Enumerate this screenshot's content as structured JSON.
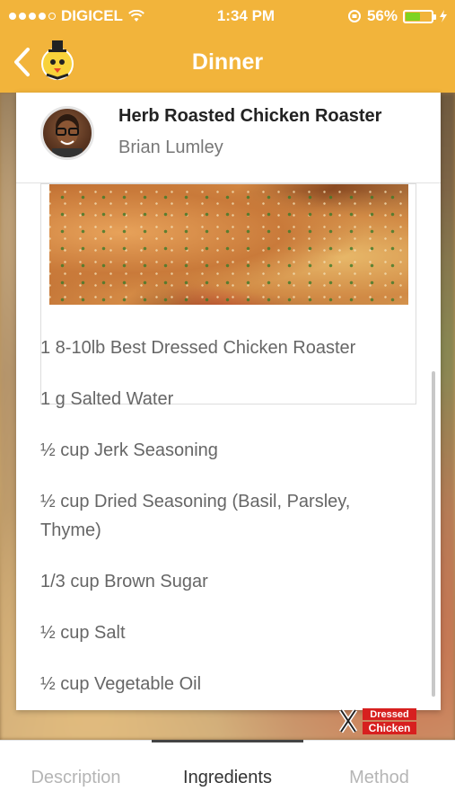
{
  "status_bar": {
    "carrier": "DIGICEL",
    "time": "1:34 PM",
    "battery_percent": "56%",
    "battery_level": 0.56
  },
  "nav": {
    "title": "Dinner",
    "back_icon": "chevron-left-icon",
    "logo_icon": "chicken-mascot-logo"
  },
  "recipe": {
    "title": "Herb Roasted Chicken Roaster",
    "author": "Brian Lumley"
  },
  "ingredients": [
    "1 8-10lb Best Dressed Chicken Roaster",
    "1 g Salted Water",
    "½ cup Jerk Seasoning",
    "½ cup Dried Seasoning (Basil, Parsley, Thyme)",
    "1/3 cup Brown Sugar",
    "½ cup Salt",
    "½ cup Vegetable Oil"
  ],
  "brand": {
    "line1": "Dressed",
    "line2": "Chicken"
  },
  "tabs": [
    {
      "label": "Description",
      "active": false
    },
    {
      "label": "Ingredients",
      "active": true
    },
    {
      "label": "Method",
      "active": false
    }
  ],
  "colors": {
    "header_bg": "#f2b43b",
    "battery_fill": "#7ed321"
  }
}
